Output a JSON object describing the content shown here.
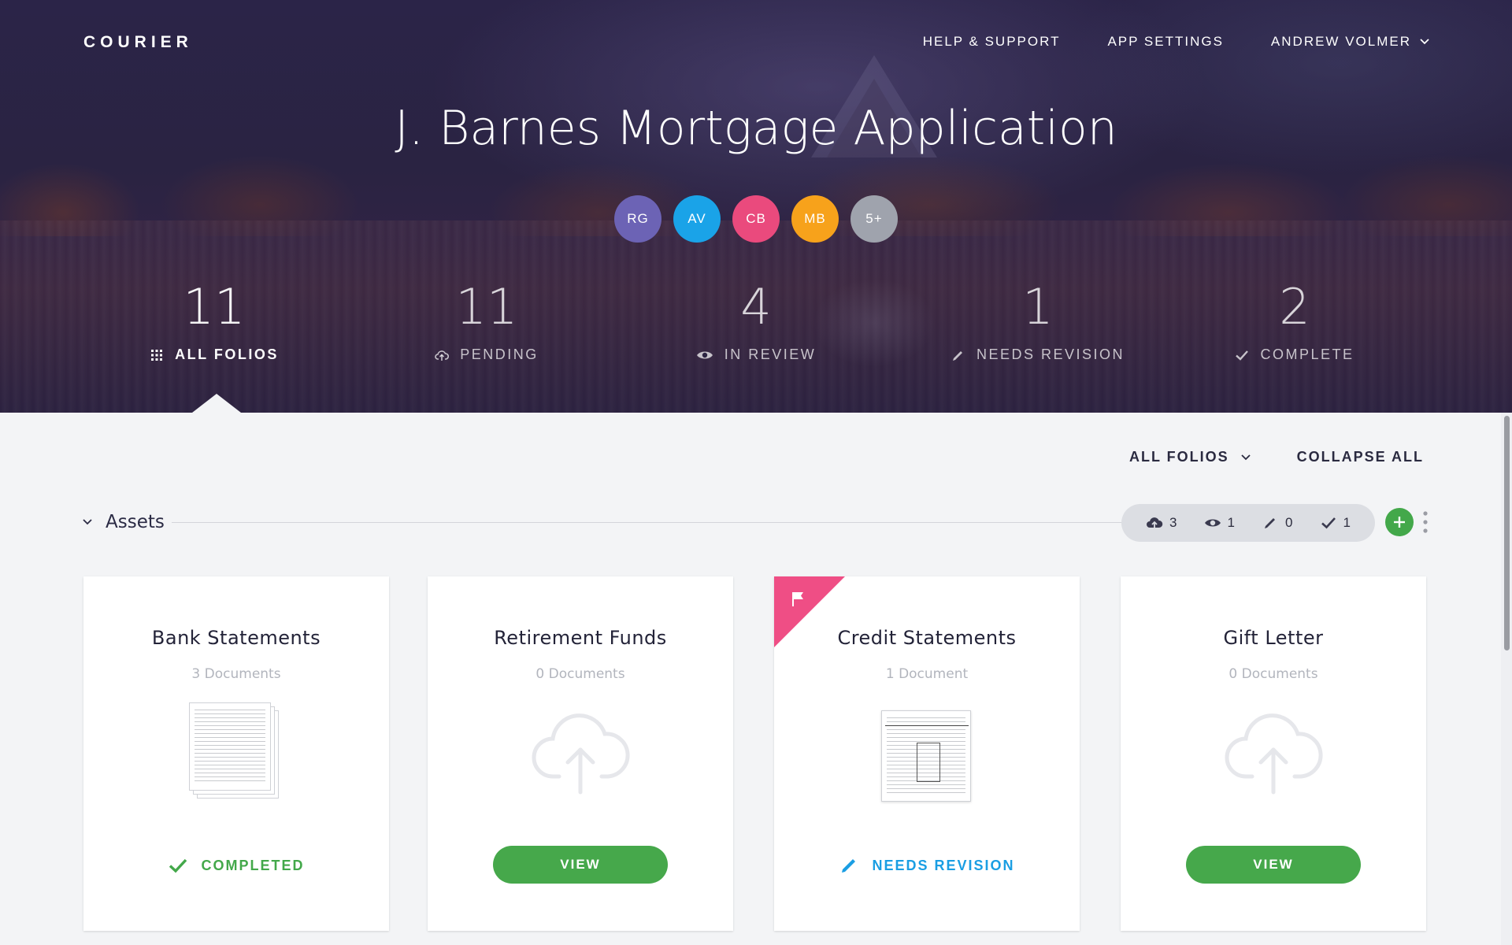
{
  "app": {
    "brand": "COURIER",
    "nav": {
      "help": "HELP & SUPPORT",
      "settings": "APP SETTINGS",
      "user": "ANDREW VOLMER"
    }
  },
  "header": {
    "title": "J. Barnes Mortgage Application",
    "avatars": [
      {
        "initials": "RG",
        "color": "#6c63b5"
      },
      {
        "initials": "AV",
        "color": "#1aa3e8"
      },
      {
        "initials": "CB",
        "color": "#ea4a7d"
      },
      {
        "initials": "MB",
        "color": "#f7a21b"
      },
      {
        "initials": "5+",
        "color": "#9fa3ad"
      }
    ],
    "stats": [
      {
        "value": "11",
        "label": "ALL FOLIOS",
        "icon": "grid-icon",
        "active": true
      },
      {
        "value": "11",
        "label": "PENDING",
        "icon": "cloud-upload-icon",
        "active": false
      },
      {
        "value": "4",
        "label": "IN REVIEW",
        "icon": "eye-icon",
        "active": false
      },
      {
        "value": "1",
        "label": "NEEDS REVISION",
        "icon": "pencil-icon",
        "active": false
      },
      {
        "value": "2",
        "label": "COMPLETE",
        "icon": "check-icon",
        "active": false
      }
    ]
  },
  "toolbar": {
    "filter": "ALL FOLIOS",
    "collapse": "COLLAPSE ALL"
  },
  "section": {
    "title": "Assets",
    "counts": {
      "pending": "3",
      "review": "1",
      "revision": "0",
      "complete": "1"
    }
  },
  "cards": [
    {
      "title": "Bank Statements",
      "subtitle": "3 Documents",
      "status": "COMPLETED",
      "status_color": "#43a84a"
    },
    {
      "title": "Retirement Funds",
      "subtitle": "0 Documents",
      "button": "VIEW"
    },
    {
      "title": "Credit Statements",
      "subtitle": "1 Document",
      "status": "NEEDS REVISION",
      "status_color": "#1a9ee3",
      "flag_color": "#ef4e85"
    },
    {
      "title": "Gift Letter",
      "subtitle": "0 Documents",
      "button": "VIEW"
    }
  ],
  "colors": {
    "accent_green": "#43a84a",
    "hero_dark": "#2a2342",
    "background": "#f3f4f6"
  }
}
